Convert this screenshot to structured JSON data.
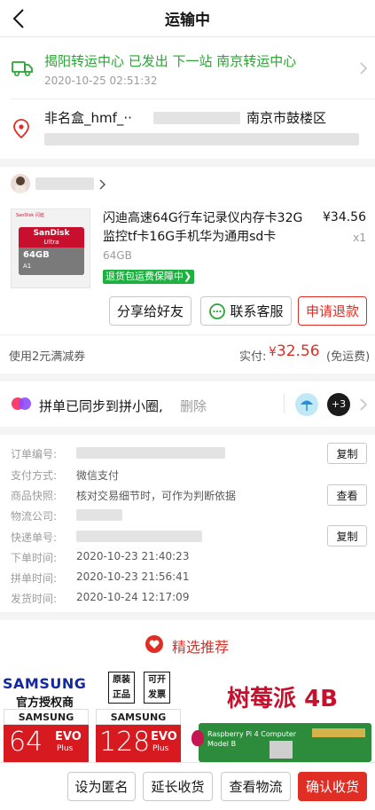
{
  "header": {
    "title": "运输中"
  },
  "logistics": {
    "status": "揭阳转运中心 已发出 下一站 南京转运中心",
    "time": "2020-10-25 02:51:32"
  },
  "address": {
    "name": "非名盒_hmf_··",
    "city": "南京市鼓楼区"
  },
  "product": {
    "title": "闪迪高速64G行车记录仪内存卡32G监控tf卡16G手机华为通用sd卡",
    "price": "¥34.56",
    "quantity": "x1",
    "spec": "64GB",
    "badge": "退货包运费保障中",
    "badge_arrow": "❯",
    "image_text": {
      "brand_small": "SanDisk 闪迪",
      "brand": "SanDisk",
      "series": "Ultra",
      "capacity": "64GB",
      "class": "A1"
    }
  },
  "actions": {
    "share": "分享给好友",
    "service": "联系客服",
    "refund": "申请退款"
  },
  "payment": {
    "coupon": "使用2元满减券",
    "paid_label": "实付:",
    "paid_symbol": "¥",
    "paid_amount": "32.56",
    "paid_note": "(免运费)"
  },
  "pindan": {
    "text": "拼单已同步到拼小圈,",
    "delete": "删除",
    "badge_count": "+3"
  },
  "order_info": {
    "rows": [
      {
        "label": "订单编号:",
        "value": "",
        "button": "复制"
      },
      {
        "label": "支付方式:",
        "value": "微信支付",
        "button": ""
      },
      {
        "label": "商品快照:",
        "value": "核对交易细节时，可作为判断依据",
        "button": "查看"
      },
      {
        "label": "物流公司:",
        "value": "",
        "button": ""
      },
      {
        "label": "快递单号:",
        "value": "",
        "button": "复制"
      },
      {
        "label": "下单时间:",
        "value": "2020-10-23 21:40:23",
        "button": ""
      },
      {
        "label": "拼单时间:",
        "value": "2020-10-23 21:56:41",
        "button": ""
      },
      {
        "label": "发货时间:",
        "value": "2020-10-24 12:17:09",
        "button": ""
      }
    ]
  },
  "recommend": {
    "title": "精选推荐",
    "left_promo": {
      "brand": "SAMSUNG",
      "auth": "官方授权商",
      "tag1a": "原装",
      "tag1b": "正品",
      "tag2a": "可开",
      "tag2b": "发票",
      "card_brand": "SAMSUNG",
      "cap1": "64",
      "cap2": "128",
      "evo": "EVO",
      "plus": "Plus"
    },
    "right_promo": {
      "title": "树莓派 4B",
      "board_label": "Raspberry Pi 4 Computer",
      "board_model": "Model B"
    }
  },
  "bottom_bar": {
    "anonymous": "设为匿名",
    "extend": "延长收货",
    "logistics": "查看物流",
    "confirm": "确认收货"
  },
  "colors": {
    "accent_red": "#e02e24",
    "logistics_green": "#2aa533",
    "badge_green": "#1fb042"
  }
}
